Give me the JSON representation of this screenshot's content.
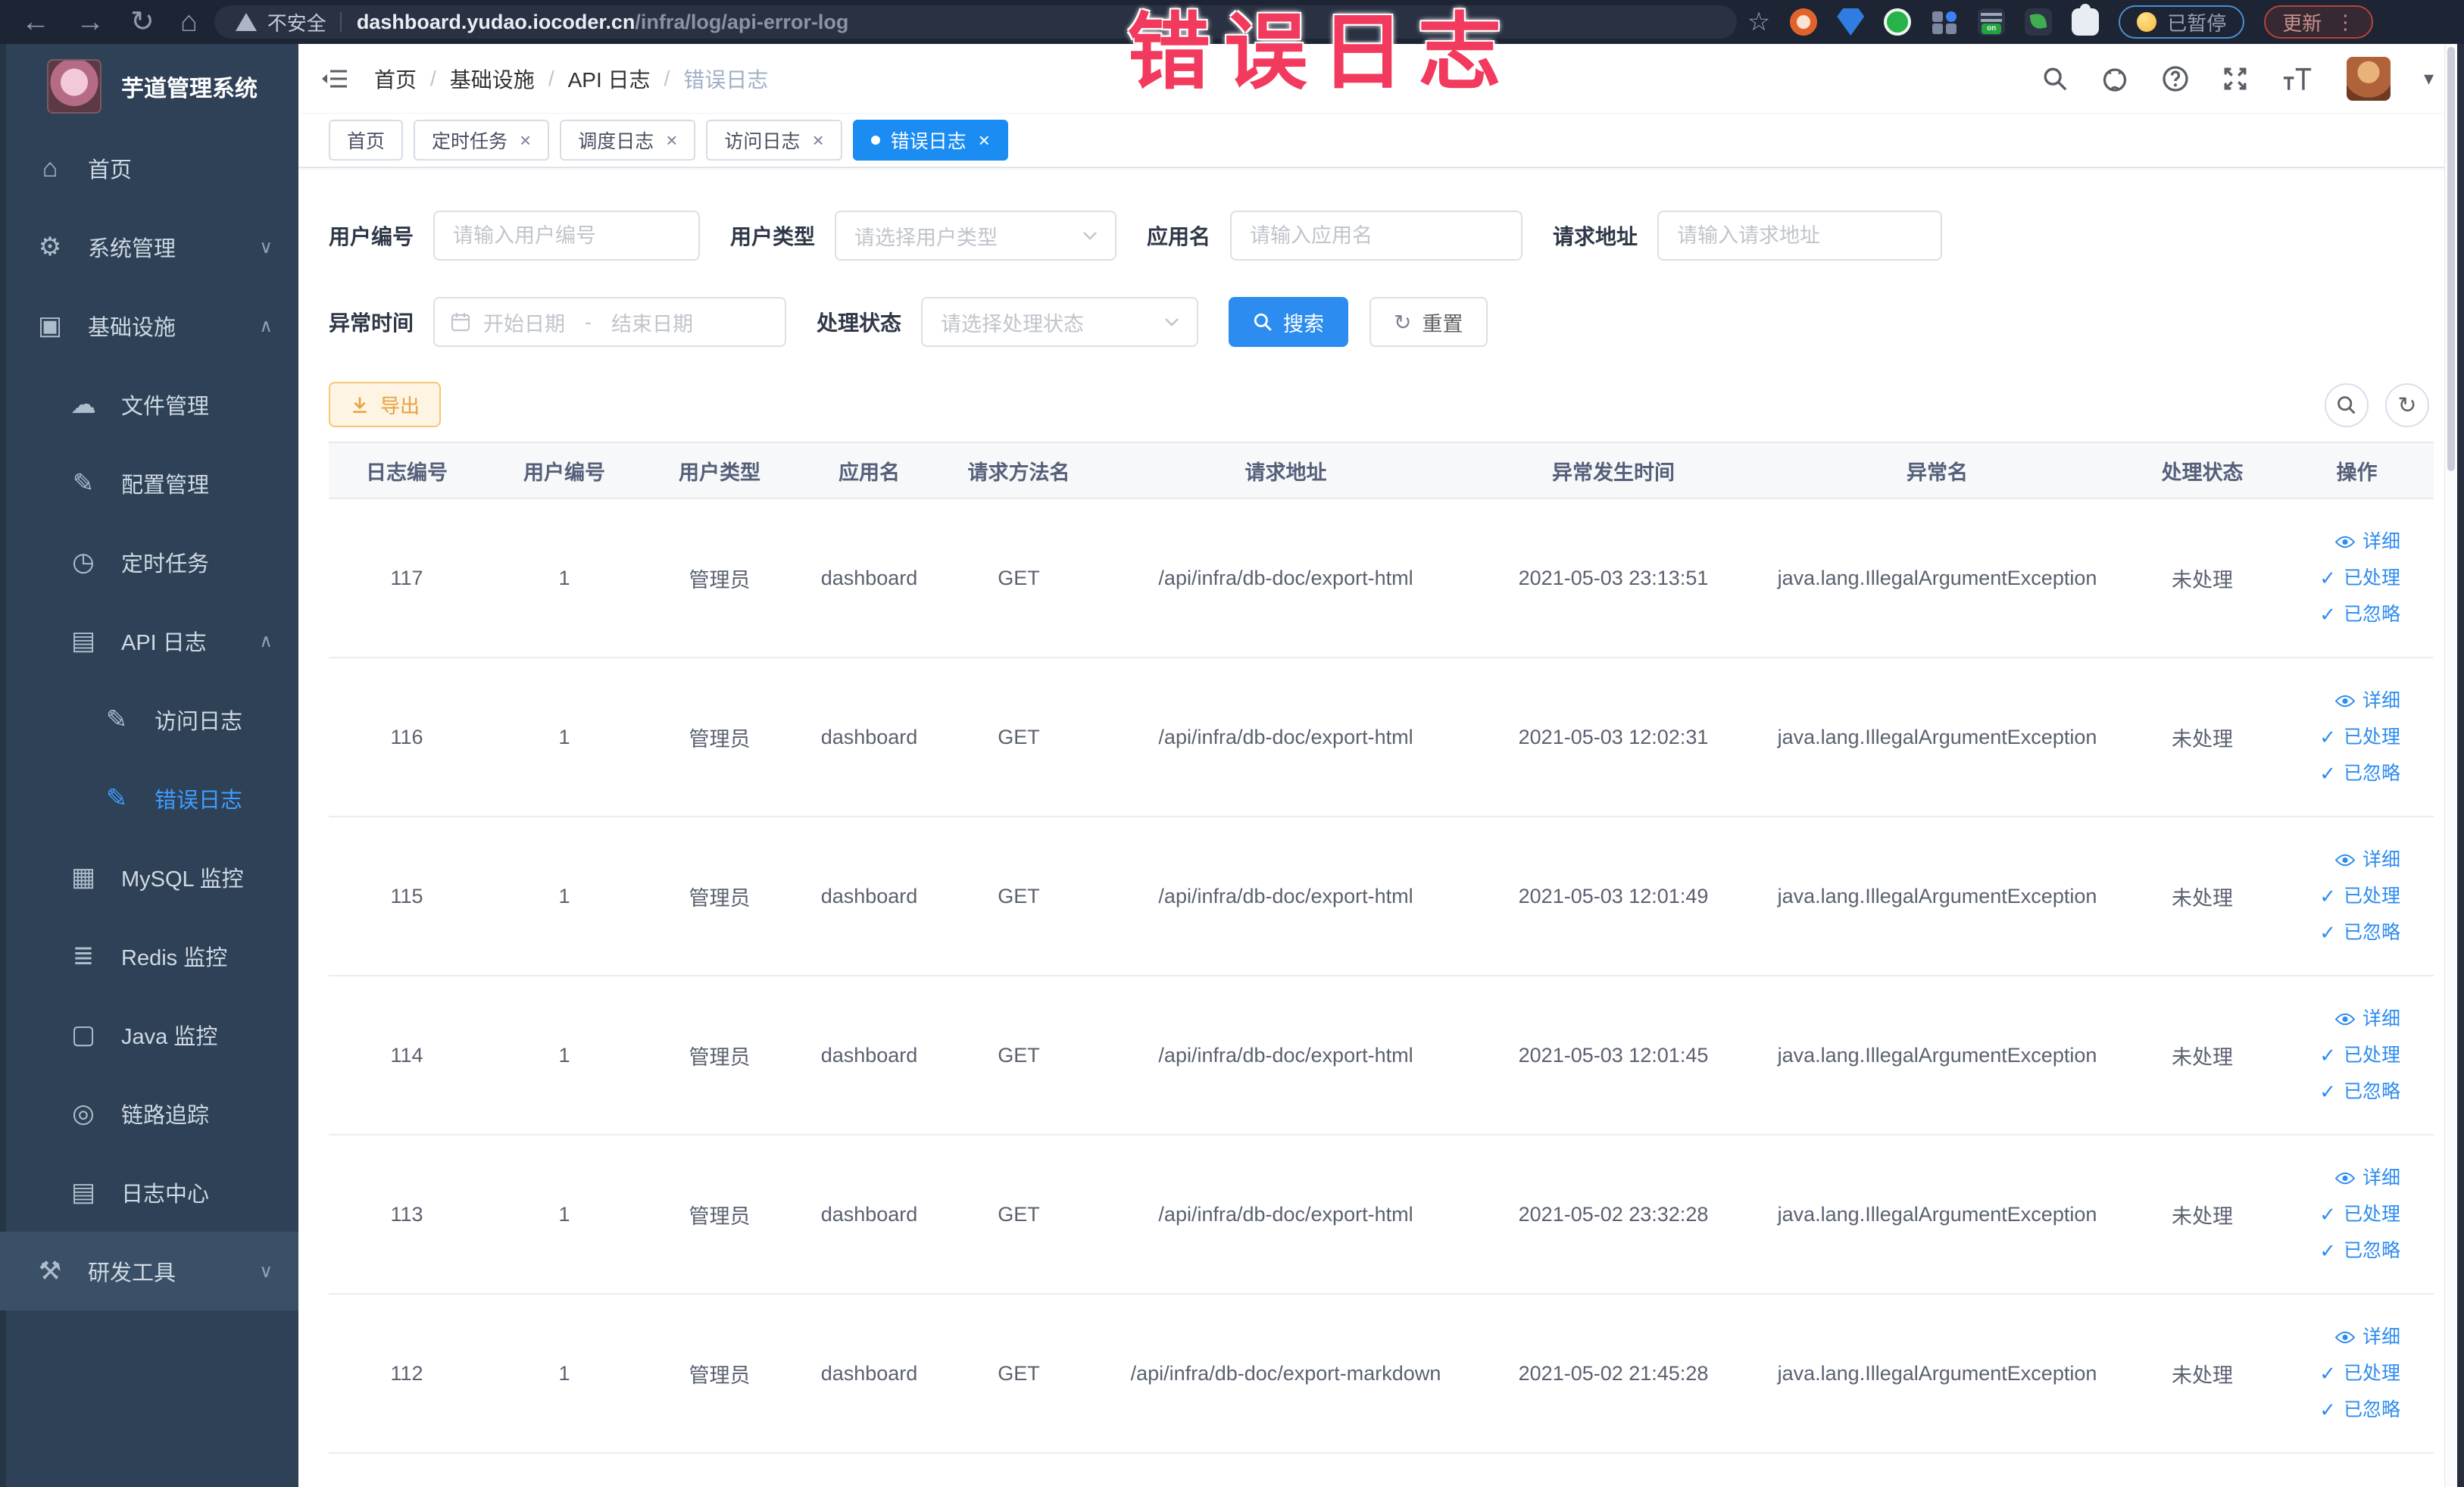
{
  "browser": {
    "security_label": "不安全",
    "url_host": "dashboard.yudao.iocoder.cn",
    "url_path": "/infra/log/api-error-log",
    "paused_label": "已暂停",
    "update_label": "更新"
  },
  "overlay": {
    "text": "错误日志"
  },
  "sidebar": {
    "title": "芋道管理系统",
    "items": [
      {
        "label": "首页",
        "icon": "home-icon",
        "level": 0
      },
      {
        "label": "系统管理",
        "icon": "gear-icon",
        "level": 0,
        "chevron": "down"
      },
      {
        "label": "基础设施",
        "icon": "infrastructure-icon",
        "level": 0,
        "chevron": "up"
      },
      {
        "label": "文件管理",
        "icon": "file-manage-icon",
        "level": 1
      },
      {
        "label": "配置管理",
        "icon": "config-manage-icon",
        "level": 1
      },
      {
        "label": "定时任务",
        "icon": "scheduled-job-icon",
        "level": 1
      },
      {
        "label": "API 日志",
        "icon": "api-log-icon",
        "level": 1,
        "chevron": "up"
      },
      {
        "label": "访问日志",
        "icon": "access-log-icon",
        "level": 2
      },
      {
        "label": "错误日志",
        "icon": "error-log-icon",
        "level": 2,
        "active": true
      },
      {
        "label": "MySQL 监控",
        "icon": "mysql-monitor-icon",
        "level": 1
      },
      {
        "label": "Redis 监控",
        "icon": "redis-monitor-icon",
        "level": 1
      },
      {
        "label": "Java 监控",
        "icon": "java-monitor-icon",
        "level": 1
      },
      {
        "label": "链路追踪",
        "icon": "trace-icon",
        "level": 1
      },
      {
        "label": "日志中心",
        "icon": "log-center-icon",
        "level": 1
      },
      {
        "label": "研发工具",
        "icon": "devtools-icon",
        "level": 0,
        "chevron": "down",
        "highlighted": true
      }
    ]
  },
  "header": {
    "breadcrumb": [
      "首页",
      "基础设施",
      "API 日志",
      "错误日志"
    ]
  },
  "tabs": [
    {
      "label": "首页",
      "closable": false,
      "active": false
    },
    {
      "label": "定时任务",
      "closable": true,
      "active": false
    },
    {
      "label": "调度日志",
      "closable": true,
      "active": false
    },
    {
      "label": "访问日志",
      "closable": true,
      "active": false
    },
    {
      "label": "错误日志",
      "closable": true,
      "active": true
    }
  ],
  "filters": {
    "user_id": {
      "label": "用户编号",
      "placeholder": "请输入用户编号"
    },
    "user_type": {
      "label": "用户类型",
      "placeholder": "请选择用户类型"
    },
    "app_name": {
      "label": "应用名",
      "placeholder": "请输入应用名"
    },
    "request_url": {
      "label": "请求地址",
      "placeholder": "请输入请求地址"
    },
    "exception_time": {
      "label": "异常时间",
      "start_placeholder": "开始日期",
      "separator": "-",
      "end_placeholder": "结束日期"
    },
    "process_status": {
      "label": "处理状态",
      "placeholder": "请选择处理状态"
    },
    "search_label": "搜索",
    "reset_label": "重置"
  },
  "toolbar": {
    "export_label": "导出"
  },
  "table": {
    "columns": [
      "日志编号",
      "用户编号",
      "用户类型",
      "应用名",
      "请求方法名",
      "请求地址",
      "异常发生时间",
      "异常名",
      "处理状态",
      "操作"
    ],
    "action_labels": [
      "详细",
      "已处理",
      "已忽略"
    ],
    "rows": [
      {
        "id": "117",
        "user_id": "1",
        "user_type": "管理员",
        "app": "dashboard",
        "method": "GET",
        "url": "/api/infra/db-doc/export-html",
        "time": "2021-05-03 23:13:51",
        "exception": "java.lang.IllegalArgumentException",
        "status": "未处理"
      },
      {
        "id": "116",
        "user_id": "1",
        "user_type": "管理员",
        "app": "dashboard",
        "method": "GET",
        "url": "/api/infra/db-doc/export-html",
        "time": "2021-05-03 12:02:31",
        "exception": "java.lang.IllegalArgumentException",
        "status": "未处理"
      },
      {
        "id": "115",
        "user_id": "1",
        "user_type": "管理员",
        "app": "dashboard",
        "method": "GET",
        "url": "/api/infra/db-doc/export-html",
        "time": "2021-05-03 12:01:49",
        "exception": "java.lang.IllegalArgumentException",
        "status": "未处理"
      },
      {
        "id": "114",
        "user_id": "1",
        "user_type": "管理员",
        "app": "dashboard",
        "method": "GET",
        "url": "/api/infra/db-doc/export-html",
        "time": "2021-05-03 12:01:45",
        "exception": "java.lang.IllegalArgumentException",
        "status": "未处理"
      },
      {
        "id": "113",
        "user_id": "1",
        "user_type": "管理员",
        "app": "dashboard",
        "method": "GET",
        "url": "/api/infra/db-doc/export-html",
        "time": "2021-05-02 23:32:28",
        "exception": "java.lang.IllegalArgumentException",
        "status": "未处理"
      },
      {
        "id": "112",
        "user_id": "1",
        "user_type": "管理员",
        "app": "dashboard",
        "method": "GET",
        "url": "/api/infra/db-doc/export-markdown",
        "time": "2021-05-02 21:45:28",
        "exception": "java.lang.IllegalArgumentException",
        "status": "未处理"
      }
    ]
  }
}
